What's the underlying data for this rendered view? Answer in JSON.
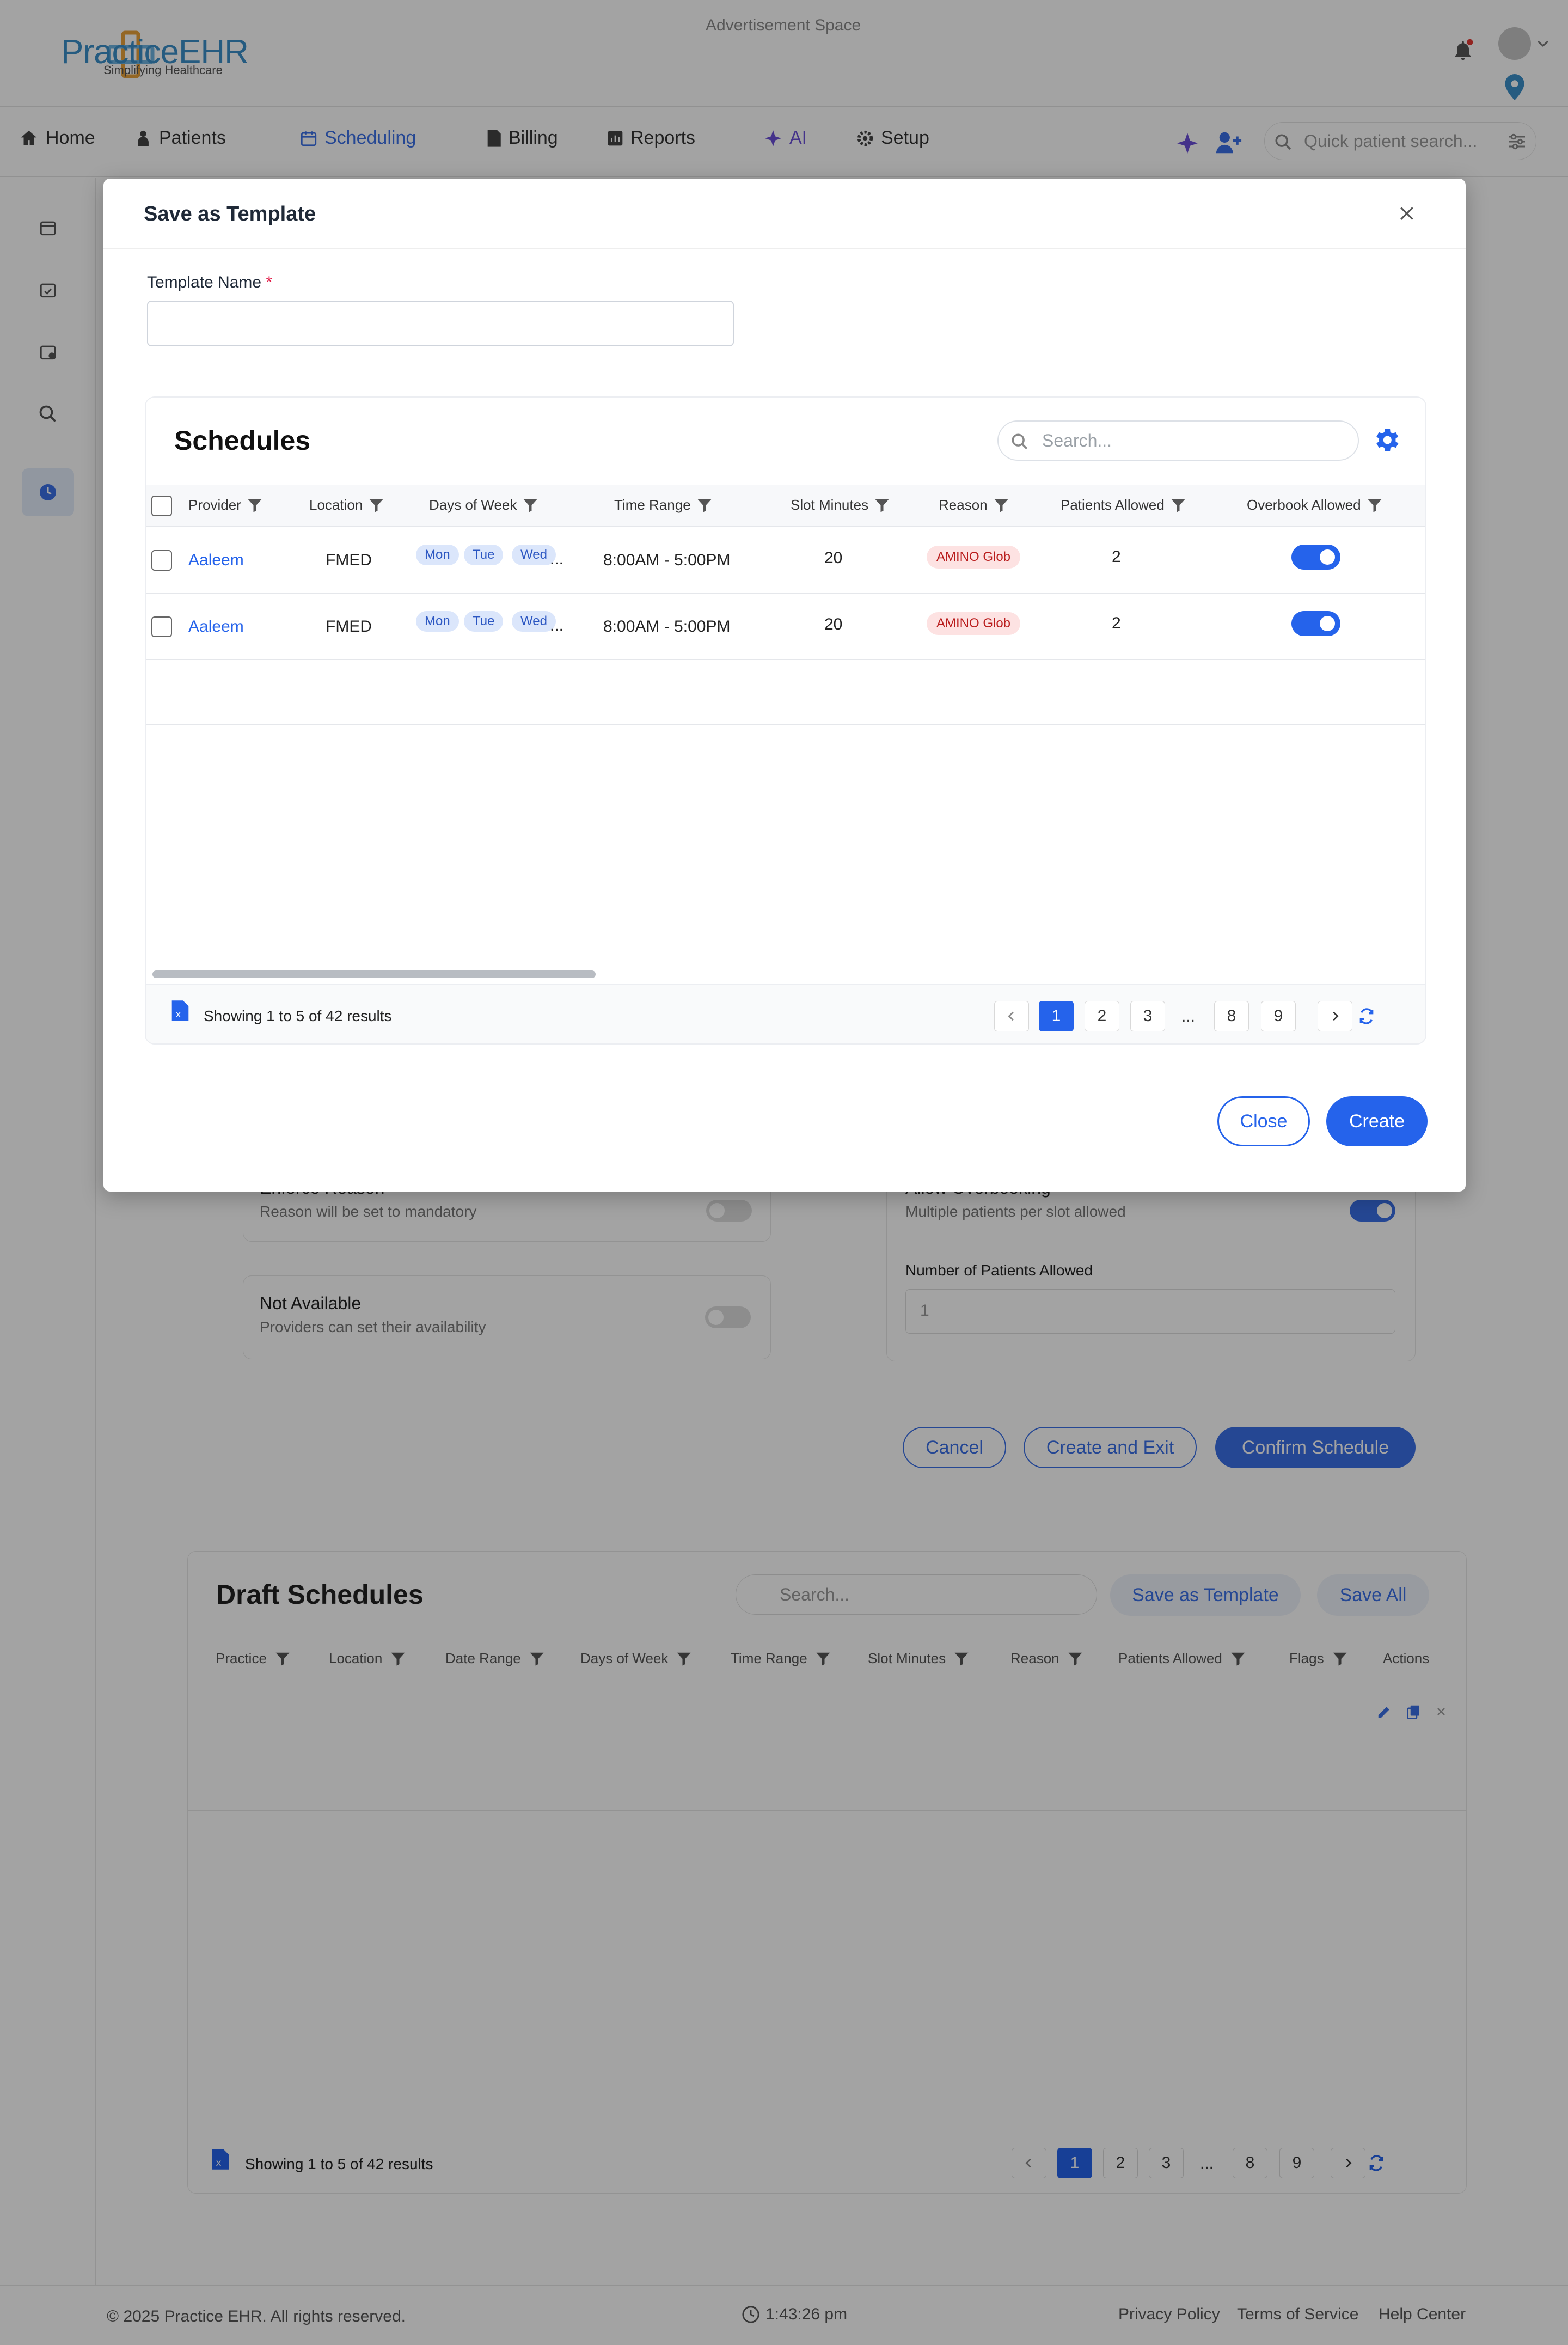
{
  "app": {
    "logo_name": "PracticeEHR",
    "logo_tagline": "Simplifying Healthcare",
    "ad_space": "Advertisement Space"
  },
  "nav": {
    "items": [
      {
        "label": "Home",
        "icon": "home-icon"
      },
      {
        "label": "Patients",
        "icon": "patient-icon"
      },
      {
        "label": "Scheduling",
        "icon": "calendar-icon",
        "active": true
      },
      {
        "label": "Billing",
        "icon": "billing-icon"
      },
      {
        "label": "Reports",
        "icon": "reports-icon"
      },
      {
        "label": "AI",
        "icon": "sparkle-icon"
      },
      {
        "label": "Setup",
        "icon": "gear-icon"
      }
    ],
    "search_placeholder": "Quick patient search..."
  },
  "background_form": {
    "enforce_reason_label": "Enforce Reason",
    "enforce_reason_sub": "Reason will be set to mandatory",
    "allow_overbooking_label": "Allow Overbooking",
    "allow_overbooking_sub": "Multiple patients per slot allowed",
    "not_available_label": "Not Available",
    "not_available_sub": "Providers can set their availability",
    "patients_allowed_label": "Number of Patients Allowed",
    "patients_allowed_value": "1",
    "cancel": "Cancel",
    "create_exit": "Create and Exit",
    "confirm": "Confirm Schedule"
  },
  "drafts": {
    "title": "Draft Schedules",
    "search_placeholder": "Search...",
    "save_template": "Save as Template",
    "save_all": "Save All",
    "columns": [
      "Practice",
      "Location",
      "Date Range",
      "Days of Week",
      "Time Range",
      "Slot Minutes",
      "Reason",
      "Patients Allowed",
      "Flags",
      "Actions"
    ],
    "results": "Showing 1 to 5 of 42 results",
    "pages": [
      "1",
      "2",
      "3",
      "...",
      "8",
      "9"
    ]
  },
  "modal": {
    "title": "Save as Template",
    "template_name_label": "Template Name",
    "required_mark": "*",
    "template_name_value": "",
    "schedules": {
      "title": "Schedules",
      "search_placeholder": "Search...",
      "columns": [
        "Provider",
        "Location",
        "Days of Week",
        "Time Range",
        "Slot Minutes",
        "Reason",
        "Patients Allowed",
        "Overbook Allowed"
      ],
      "rows": [
        {
          "provider": "Aaleem",
          "location": "FMED",
          "days": [
            "Mon",
            "Tue",
            "Wed"
          ],
          "more": "...",
          "time": "8:00AM - 5:00PM",
          "slot": "20",
          "reason": "AMINO Glob",
          "patients": "2",
          "overbook": true
        },
        {
          "provider": "Aaleem",
          "location": "FMED",
          "days": [
            "Mon",
            "Tue",
            "Wed"
          ],
          "more": "...",
          "time": "8:00AM - 5:00PM",
          "slot": "20",
          "reason": "AMINO Glob",
          "patients": "2",
          "overbook": true
        }
      ],
      "results": "Showing 1 to 5 of 42 results",
      "pages": [
        "1",
        "2",
        "3",
        "...",
        "8",
        "9"
      ],
      "current_page": "1"
    },
    "close_label": "Close",
    "create_label": "Create"
  },
  "footer": {
    "copyright": "© 2025 Practice EHR. All rights reserved.",
    "time": "1:43:26 pm",
    "privacy": "Privacy Policy",
    "terms": "Terms of Service",
    "help": "Help Center"
  },
  "colors": {
    "accent": "#2563eb",
    "reason_bg": "#fde2e2",
    "reason_text": "#b91c1c",
    "day_pill_bg": "#dbe6fb"
  }
}
